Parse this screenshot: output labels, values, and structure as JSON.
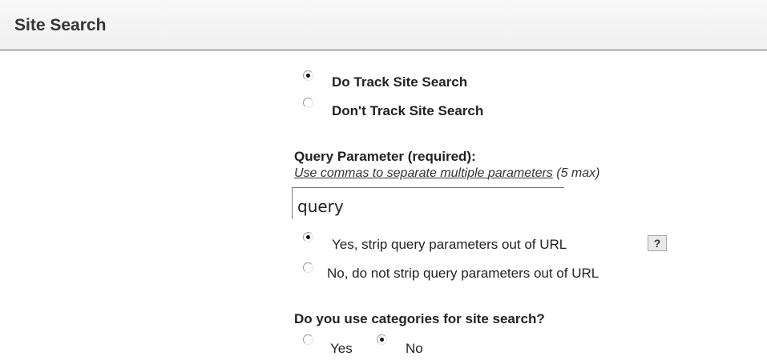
{
  "section": {
    "title": "Site Search"
  },
  "tracking": {
    "options": [
      {
        "label": "Do Track Site Search",
        "checked": true
      },
      {
        "label": "Don't Track Site Search",
        "checked": false
      }
    ]
  },
  "query_parameter": {
    "label": "Query Parameter (required):",
    "hint_prefix": "Use commas to separate multiple ",
    "hint_underlined": "parameters",
    "hint_suffix": " (5 max)",
    "value": "query"
  },
  "strip": {
    "options": [
      {
        "label": "Yes, strip query parameters out of URL",
        "checked": true
      },
      {
        "label": "No, do not strip query parameters out of URL",
        "checked": false
      }
    ],
    "help_label": "?"
  },
  "categories": {
    "question": "Do you use categories for site search?",
    "options": [
      {
        "label": "Yes",
        "checked": false
      },
      {
        "label": "No",
        "checked": true
      }
    ]
  }
}
